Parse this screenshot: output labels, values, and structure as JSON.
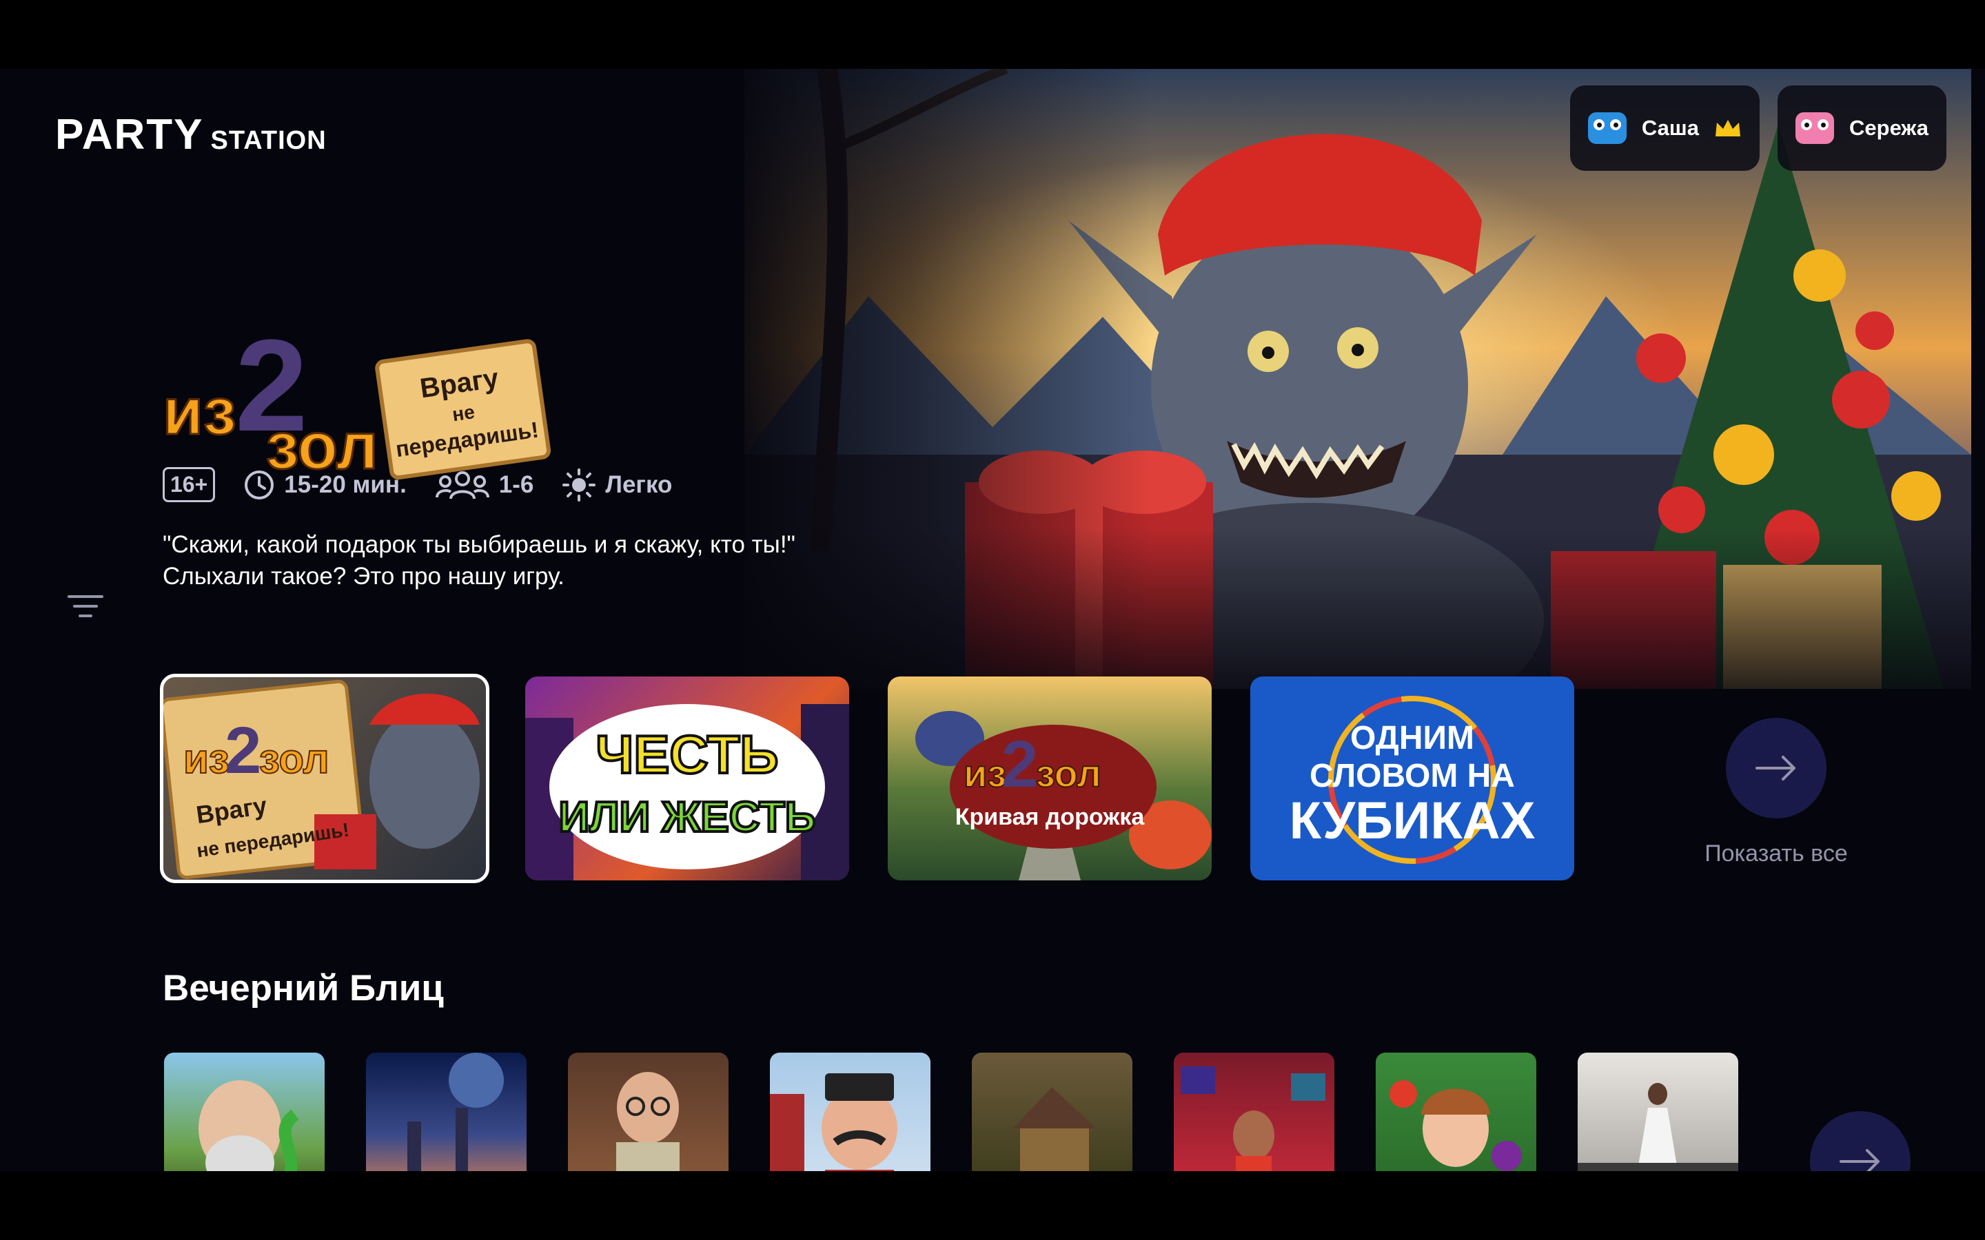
{
  "brand": {
    "party": "PARTY",
    "station": "STATION"
  },
  "profiles": [
    {
      "name": "Саша",
      "avatar": "blue-face-avatar",
      "badge": "crown-icon",
      "avatar_color": "#2b8fe0"
    },
    {
      "name": "Сережа",
      "avatar": "pink-face-avatar",
      "avatar_color": "#f07fb0"
    }
  ],
  "featured": {
    "title_art": {
      "line1_a": "из",
      "digit": "2",
      "line1_b": "зол",
      "scroll_1": "Врагу",
      "scroll_2": "не",
      "scroll_3": "передаришь!"
    },
    "age": "16+",
    "duration": "15-20 мин.",
    "players": "1-6",
    "difficulty": "Легко",
    "description": "\"Скажи, какой подарок ты выбираешь и я скажу, кто ты!\" Слыхали такое? Это про нашу игру."
  },
  "carousel": [
    {
      "name": "izzol-vragu",
      "art_a": "из",
      "art_digit": "2",
      "art_b": "зол",
      "art_c": "Врагу",
      "art_d": "не передаришь!",
      "selected": true
    },
    {
      "name": "chest-ili-zhest",
      "art_a": "ЧЕСТЬ",
      "art_b": "ИЛИ ЖЕСТЬ"
    },
    {
      "name": "izzol-krivaya",
      "art_a": "из",
      "art_digit": "2",
      "art_b": "зол",
      "art_c": "Кривая дорожка"
    },
    {
      "name": "odnim-slovom",
      "art_a": "ОДНИМ",
      "art_b": "СЛОВОМ НА",
      "art_c": "КУБИКАХ"
    }
  ],
  "show_all_label": "Показать все",
  "section": {
    "title": "Вечерний Блиц",
    "thumbs": [
      "old-man-snake",
      "space-city",
      "librarian",
      "mustache-man",
      "forest-house",
      "gifts-girl",
      "fruit-girl",
      "orchestra"
    ]
  },
  "colors": {
    "accent_circle": "#1a1a4a",
    "background": "#05050d",
    "muted_text": "#9495aa"
  }
}
